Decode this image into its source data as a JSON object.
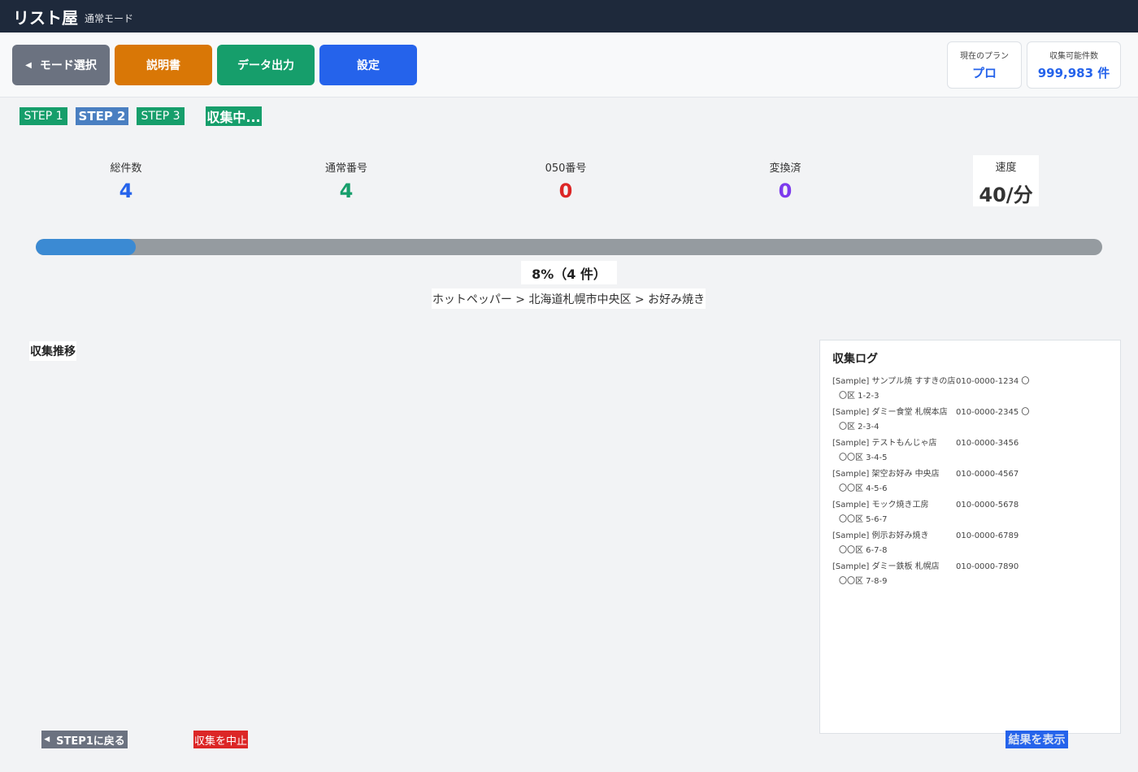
{
  "header": {
    "title": "リスト屋",
    "mode": "通常モード"
  },
  "toolbar": {
    "mode_select": "モード選択",
    "manual": "説明書",
    "export": "データ出力",
    "settings": "設定",
    "plan_label": "現在のプラン",
    "plan_value": "プロ",
    "quota_label": "収集可能件数",
    "quota_value": "999,983 件"
  },
  "steps": {
    "step1": "STEP 1",
    "step2": "STEP 2",
    "step3": "STEP 3",
    "status": "収集中..."
  },
  "stats": {
    "total_label": "総件数",
    "total_value": "4",
    "normal_label": "通常番号",
    "normal_value": "4",
    "o50_label": "050番号",
    "o50_value": "0",
    "converted_label": "変換済",
    "converted_value": "0",
    "speed_label": "速度",
    "speed_value": "40/分"
  },
  "progress": {
    "percent": 8,
    "text": "8%（4 件）",
    "breadcrumb": "ホットペッパー > 北海道札幌市中央区 > お好み焼き"
  },
  "chart": {
    "title": "収集推移"
  },
  "log": {
    "title": "収集ログ",
    "entries": [
      {
        "name": "[Sample] サンプル焼 すすきの店",
        "phone": "010-0000-1234 〇",
        "addr": "〇区 1-2-3"
      },
      {
        "name": "[Sample] ダミー食堂 札幌本店",
        "phone": "010-0000-2345 〇",
        "addr": "〇区 2-3-4"
      },
      {
        "name": "[Sample] テストもんじゃ店",
        "phone": "010-0000-3456",
        "addr": "〇〇区 3-4-5"
      },
      {
        "name": "[Sample] 架空お好み 中央店",
        "phone": "010-0000-4567",
        "addr": "〇〇区 4-5-6"
      },
      {
        "name": "[Sample] モック焼き工房",
        "phone": "010-0000-5678",
        "addr": "〇〇区 5-6-7"
      },
      {
        "name": "[Sample] 例示お好み焼き",
        "phone": "010-0000-6789",
        "addr": "〇〇区 6-7-8"
      },
      {
        "name": "[Sample] ダミー鉄板 札幌店",
        "phone": "010-0000-7890",
        "addr": "〇〇区 7-8-9"
      }
    ]
  },
  "footer": {
    "back": "STEP1に戻る",
    "stop": "収集を中止",
    "result": "結果を表示"
  }
}
